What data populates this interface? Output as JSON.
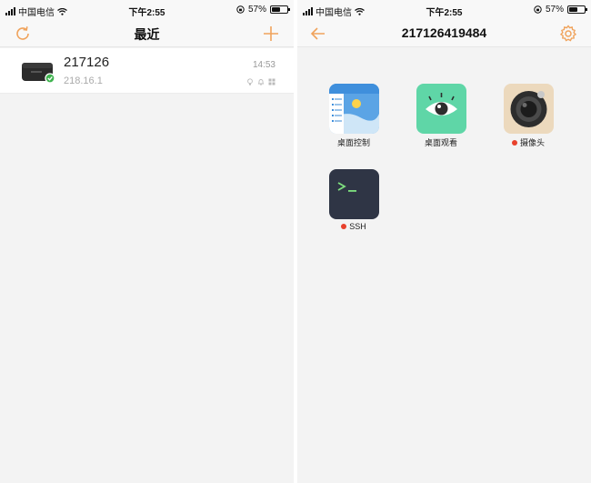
{
  "status_bar": {
    "carrier": "中国电信",
    "time": "下午2:55",
    "battery": "57%",
    "battery_level": 0.57
  },
  "left_screen": {
    "nav": {
      "title": "最近",
      "refresh_icon": "refresh-icon",
      "add_icon": "plus-icon"
    },
    "recent_device": {
      "name": "217126",
      "ip": "218.16.1",
      "time": "14:53",
      "status_icons": [
        "bulb-icon",
        "bell-icon",
        "windows-icon"
      ]
    }
  },
  "right_screen": {
    "nav": {
      "title": "217126419484",
      "back_icon": "back-arrow-icon",
      "settings_icon": "gear-icon"
    },
    "apps": [
      {
        "label": "桌面控制",
        "icon": "desktop-control-icon",
        "status_dot": false
      },
      {
        "label": "桌面观看",
        "icon": "desktop-view-eye-icon",
        "status_dot": false
      },
      {
        "label": "摄像头",
        "icon": "camera-icon",
        "status_dot": true
      },
      {
        "label": "SSH",
        "icon": "terminal-icon",
        "status_dot": true
      }
    ]
  },
  "colors": {
    "accent": "#f0a35c",
    "status_dot": "#e8412c",
    "background": "#f3f3f3"
  }
}
